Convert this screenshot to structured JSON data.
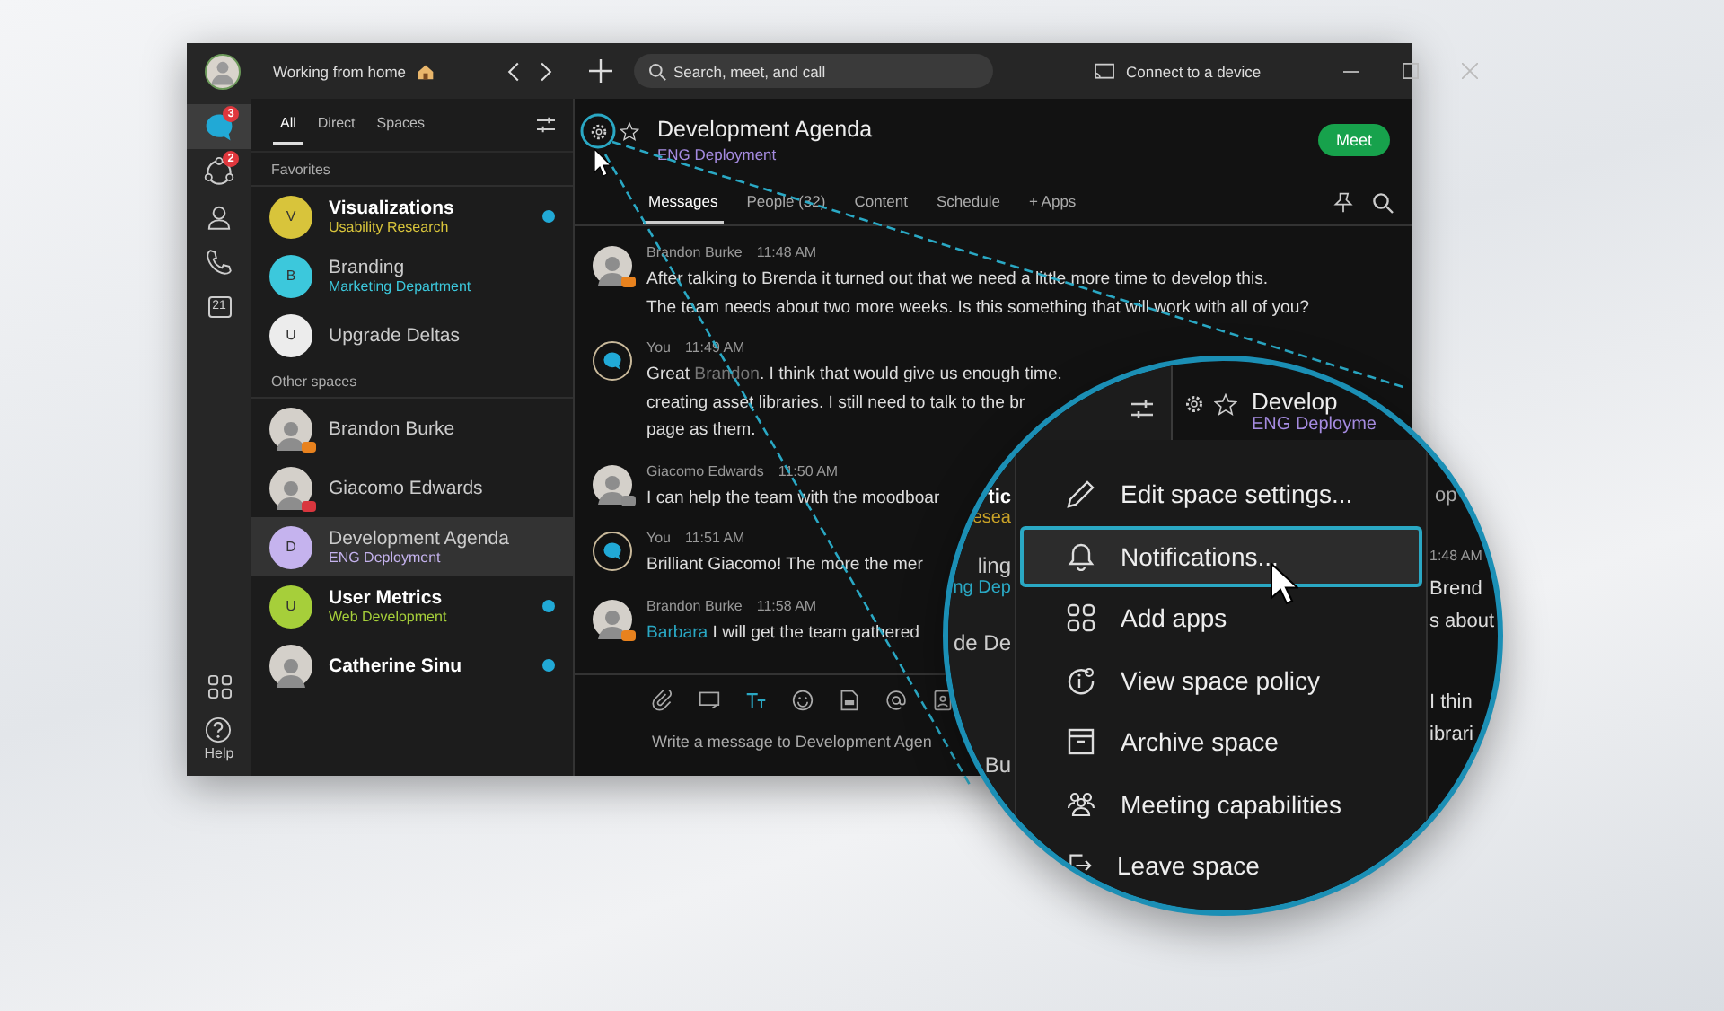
{
  "titlebar": {
    "status": "Working from home",
    "search_placeholder": "Search, meet, and call",
    "connect_label": "Connect to a device"
  },
  "rail": {
    "items": [
      {
        "kind": "messaging",
        "badge": "3",
        "selected": true
      },
      {
        "kind": "teams",
        "badge": "2",
        "selected": false
      },
      {
        "kind": "contacts",
        "selected": false
      },
      {
        "kind": "calls",
        "selected": false
      },
      {
        "kind": "calendar",
        "label": "21",
        "selected": false
      }
    ],
    "help_label": "Help"
  },
  "space_list": {
    "filters": [
      {
        "label": "All",
        "selected": true
      },
      {
        "label": "Direct",
        "selected": false
      },
      {
        "label": "Spaces",
        "selected": false
      }
    ],
    "sections": [
      {
        "title": "Favorites",
        "spaces": [
          {
            "name": "Visualizations",
            "subtitle": "Usability Research",
            "initial": "V",
            "color": "#d8c43b",
            "unread": true,
            "selected": false
          },
          {
            "name": "Branding",
            "subtitle": "Marketing Department",
            "initial": "B",
            "color": "#3cc8dc",
            "unread": false,
            "selected": false
          },
          {
            "name": "Upgrade Deltas",
            "initial": "U",
            "color": "#ececec",
            "unread": false,
            "selected": false
          }
        ]
      },
      {
        "title": "Other spaces",
        "spaces": [
          {
            "name": "Brandon Burke",
            "color": "#e8821e",
            "unread": false,
            "selected": false
          },
          {
            "name": "Giacomo Edwards",
            "color": "#d9363e",
            "unread": false,
            "selected": false
          },
          {
            "name": "Development Agenda",
            "subtitle": "ENG Deployment",
            "initial": "D",
            "color": "#c5b3ee",
            "unread": false,
            "selected": true
          },
          {
            "name": "User Metrics",
            "subtitle": "Web Development",
            "initial": "U",
            "color": "#a6cf3a",
            "unread": true,
            "selected": false
          },
          {
            "name": "Catherine Sinu",
            "unread": true,
            "selected": false
          }
        ]
      }
    ]
  },
  "space": {
    "title": "Development Agenda",
    "subtitle": "ENG Deployment",
    "meet_label": "Meet",
    "tabs": [
      {
        "label": "Messages",
        "selected": true
      },
      {
        "label": "People (32)",
        "selected": false
      },
      {
        "label": "Content",
        "selected": false
      },
      {
        "label": "Schedule",
        "selected": false
      },
      {
        "label": "+ Apps",
        "selected": false
      }
    ],
    "messages": [
      {
        "kind": "person",
        "author": "Brandon Burke",
        "time": "11:48 AM",
        "color": "#e8821e",
        "lines": [
          [
            {
              "text": "After talking to Brenda it turned out that we need a little more time to develop this.",
              "kind": "plain"
            }
          ],
          [
            {
              "text": "The team needs about two more weeks. Is this something that will work with all of you?",
              "kind": "plain"
            }
          ]
        ]
      },
      {
        "kind": "self",
        "author": "You",
        "time": "11:49 AM",
        "lines": [
          [
            {
              "text": "Great ",
              "kind": "plain"
            },
            {
              "text": "Brandon",
              "kind": "mention"
            },
            {
              "text": ". I think that would give us enough time.",
              "kind": "plain"
            }
          ],
          [
            {
              "text": "creating asset libraries. I still need to talk to the br",
              "kind": "plain"
            }
          ],
          [
            {
              "text": "page as them.",
              "kind": "plain"
            }
          ]
        ]
      },
      {
        "kind": "person",
        "author": "Giacomo Edwards",
        "time": "11:50 AM",
        "color": "#8a8a8a",
        "lines": [
          [
            {
              "text": "I can help the team with the moodboar",
              "kind": "plain"
            }
          ]
        ]
      },
      {
        "kind": "self",
        "author": "You",
        "time": "11:51 AM",
        "lines": [
          [
            {
              "text": "Brilliant Giacomo! The more the mer",
              "kind": "plain"
            }
          ]
        ]
      },
      {
        "kind": "person",
        "author": "Brandon Burke",
        "time": "11:58 AM",
        "color": "#e8821e",
        "lines": [
          [
            {
              "text": "Barbara",
              "kind": "link"
            },
            {
              "text": " I will get the team gathered",
              "kind": "plain"
            }
          ]
        ]
      }
    ],
    "composer": {
      "placeholder": "Write a message to Development Agen"
    }
  },
  "magnifier": {
    "title": "Develop",
    "subtitle": "ENG Deployme",
    "left_rows": [
      {
        "title": "tic",
        "subtitle": "esea",
        "color": "#c9a227",
        "unread": true
      },
      {
        "title": "ling",
        "subtitle": "ng Dep",
        "color": "#2aa8c4",
        "unread": false
      },
      {
        "title": "de De",
        "unread": false
      },
      {
        "title": "Bu",
        "unread": false
      }
    ],
    "right_groups": [
      {
        "kind": "tab",
        "lines": [
          "op"
        ]
      },
      {
        "kind": "meta",
        "lines": [
          "1:48 AM"
        ]
      },
      {
        "kind": "text",
        "lines": [
          "Brend",
          "s about"
        ]
      },
      {
        "kind": "text",
        "lines": [
          "I thin",
          "ibrari"
        ]
      }
    ],
    "menu": [
      {
        "label": "Edit space settings...",
        "selected": false
      },
      {
        "label": "Notifications...",
        "selected": true
      },
      {
        "label": "Add apps",
        "selected": false
      },
      {
        "label": "View space policy",
        "selected": false
      },
      {
        "label": "Archive space",
        "selected": false
      },
      {
        "label": "Meeting capabilities",
        "selected": false
      },
      {
        "label": "Leave space",
        "selected": false
      }
    ]
  }
}
